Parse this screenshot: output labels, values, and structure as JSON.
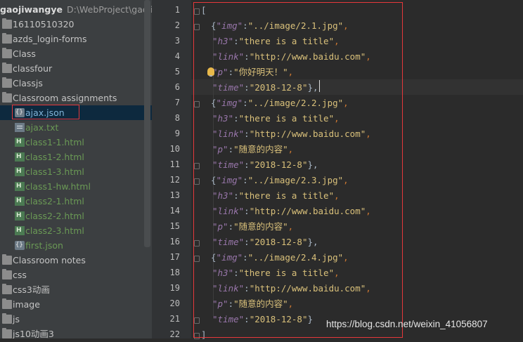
{
  "project": {
    "root_name": "gaojiwangye",
    "root_path": "D:\\WebProject\\gaojiwa"
  },
  "tree": [
    {
      "label": "16110510320",
      "icon": "folder-icon",
      "kind": "folder",
      "indent": 0
    },
    {
      "label": "azds_login-forms",
      "icon": "folder-icon",
      "kind": "folder",
      "indent": 0
    },
    {
      "label": "Class",
      "icon": "folder-icon",
      "kind": "folder",
      "indent": 0
    },
    {
      "label": "classfour",
      "icon": "folder-icon",
      "kind": "folder",
      "indent": 0
    },
    {
      "label": "Classjs",
      "icon": "folder-icon",
      "kind": "folder",
      "indent": 0
    },
    {
      "label": "Classroom assignments",
      "icon": "folder-icon",
      "kind": "folder",
      "indent": 0
    },
    {
      "label": "ajax.json",
      "icon": "json-file-icon",
      "kind": "json",
      "indent": 1,
      "selected": true
    },
    {
      "label": "ajax.txt",
      "icon": "text-file-icon",
      "kind": "txt",
      "indent": 1
    },
    {
      "label": "class1-1.html",
      "icon": "html-file-icon",
      "kind": "html",
      "indent": 1
    },
    {
      "label": "class1-2.html",
      "icon": "html-file-icon",
      "kind": "html",
      "indent": 1
    },
    {
      "label": "class1-3.html",
      "icon": "html-file-icon",
      "kind": "html",
      "indent": 1
    },
    {
      "label": "class1-hw.html",
      "icon": "html-file-icon",
      "kind": "html",
      "indent": 1
    },
    {
      "label": "class2-1.html",
      "icon": "html-file-icon",
      "kind": "html",
      "indent": 1
    },
    {
      "label": "class2-2.html",
      "icon": "html-file-icon",
      "kind": "html",
      "indent": 1
    },
    {
      "label": "class2-3.html",
      "icon": "html-file-icon",
      "kind": "html",
      "indent": 1
    },
    {
      "label": "first.json",
      "icon": "json-file-icon",
      "kind": "json",
      "indent": 1
    },
    {
      "label": "Classroom notes",
      "icon": "folder-icon",
      "kind": "folder",
      "indent": 0
    },
    {
      "label": "css",
      "icon": "folder-icon",
      "kind": "folder",
      "indent": 0
    },
    {
      "label": "css3动画",
      "icon": "folder-icon",
      "kind": "folder",
      "indent": 0
    },
    {
      "label": "image",
      "icon": "folder-icon",
      "kind": "folder",
      "indent": 0
    },
    {
      "label": "js",
      "icon": "folder-icon",
      "kind": "folder",
      "indent": 0
    },
    {
      "label": "js10动画3",
      "icon": "folder-icon",
      "kind": "folder",
      "indent": 0
    }
  ],
  "editor": {
    "line_numbers": [
      "1",
      "2",
      "3",
      "4",
      "5",
      "6",
      "7",
      "8",
      "9",
      "10",
      "11",
      "12",
      "13",
      "14",
      "15",
      "16",
      "17",
      "18",
      "19",
      "20",
      "21",
      "22"
    ],
    "lines": [
      [
        {
          "t": "[",
          "c": "b"
        }
      ],
      [
        {
          "t": "{",
          "c": "b"
        },
        {
          "t": "\"img\"",
          "c": "k"
        },
        {
          "t": ":",
          "c": "b"
        },
        {
          "t": "\"../image/2.1.jpg\"",
          "c": "s2"
        },
        {
          "t": ",",
          "c": "p"
        }
      ],
      [
        {
          "t": "  ",
          "c": "b"
        },
        {
          "t": "\"h3\"",
          "c": "k"
        },
        {
          "t": ":",
          "c": "b"
        },
        {
          "t": "\"there is a title\"",
          "c": "s2"
        },
        {
          "t": ",",
          "c": "p"
        }
      ],
      [
        {
          "t": "  ",
          "c": "b"
        },
        {
          "t": "\"link\"",
          "c": "k"
        },
        {
          "t": ":",
          "c": "b"
        },
        {
          "t": "\"http://www.baidu.com\"",
          "c": "s2"
        },
        {
          "t": ",",
          "c": "p"
        }
      ],
      [
        {
          "t": "  ",
          "c": "b"
        },
        {
          "t": "\"p\"",
          "c": "k"
        },
        {
          "t": ":",
          "c": "b"
        },
        {
          "t": "\"你好明天！\"",
          "c": "s2"
        },
        {
          "t": ",",
          "c": "p"
        }
      ],
      [
        {
          "t": "  ",
          "c": "b"
        },
        {
          "t": "\"time\"",
          "c": "k"
        },
        {
          "t": ":",
          "c": "b"
        },
        {
          "t": "\"2018-12-8\"",
          "c": "s2"
        },
        {
          "t": "},",
          "c": "b"
        }
      ],
      [
        {
          "t": "{",
          "c": "b"
        },
        {
          "t": "\"img\"",
          "c": "k"
        },
        {
          "t": ":",
          "c": "b"
        },
        {
          "t": "\"../image/2.2.jpg\"",
          "c": "s2"
        },
        {
          "t": ",",
          "c": "p"
        }
      ],
      [
        {
          "t": "  ",
          "c": "b"
        },
        {
          "t": "\"h3\"",
          "c": "k"
        },
        {
          "t": ":",
          "c": "b"
        },
        {
          "t": "\"there is a title\"",
          "c": "s2"
        },
        {
          "t": ",",
          "c": "p"
        }
      ],
      [
        {
          "t": "  ",
          "c": "b"
        },
        {
          "t": "\"link\"",
          "c": "k"
        },
        {
          "t": ":",
          "c": "b"
        },
        {
          "t": "\"http://www.baidu.com\"",
          "c": "s2"
        },
        {
          "t": ",",
          "c": "p"
        }
      ],
      [
        {
          "t": "  ",
          "c": "b"
        },
        {
          "t": "\"p\"",
          "c": "k"
        },
        {
          "t": ":",
          "c": "b"
        },
        {
          "t": "\"随意的内容\"",
          "c": "s2"
        },
        {
          "t": ",",
          "c": "p"
        }
      ],
      [
        {
          "t": "  ",
          "c": "b"
        },
        {
          "t": "\"time\"",
          "c": "k"
        },
        {
          "t": ":",
          "c": "b"
        },
        {
          "t": "\"2018-12-8\"",
          "c": "s2"
        },
        {
          "t": "},",
          "c": "b"
        }
      ],
      [
        {
          "t": "{",
          "c": "b"
        },
        {
          "t": "\"img\"",
          "c": "k"
        },
        {
          "t": ":",
          "c": "b"
        },
        {
          "t": "\"../image/2.3.jpg\"",
          "c": "s2"
        },
        {
          "t": ",",
          "c": "p"
        }
      ],
      [
        {
          "t": "  ",
          "c": "b"
        },
        {
          "t": "\"h3\"",
          "c": "k"
        },
        {
          "t": ":",
          "c": "b"
        },
        {
          "t": "\"there is a title\"",
          "c": "s2"
        },
        {
          "t": ",",
          "c": "p"
        }
      ],
      [
        {
          "t": "  ",
          "c": "b"
        },
        {
          "t": "\"link\"",
          "c": "k"
        },
        {
          "t": ":",
          "c": "b"
        },
        {
          "t": "\"http://www.baidu.com\"",
          "c": "s2"
        },
        {
          "t": ",",
          "c": "p"
        }
      ],
      [
        {
          "t": "  ",
          "c": "b"
        },
        {
          "t": "\"p\"",
          "c": "k"
        },
        {
          "t": ":",
          "c": "b"
        },
        {
          "t": "\"随意的内容\"",
          "c": "s2"
        },
        {
          "t": ",",
          "c": "p"
        }
      ],
      [
        {
          "t": "  ",
          "c": "b"
        },
        {
          "t": "\"time\"",
          "c": "k"
        },
        {
          "t": ":",
          "c": "b"
        },
        {
          "t": "\"2018-12-8\"",
          "c": "s2"
        },
        {
          "t": "},",
          "c": "b"
        }
      ],
      [
        {
          "t": "{",
          "c": "b"
        },
        {
          "t": "\"img\"",
          "c": "k"
        },
        {
          "t": ":",
          "c": "b"
        },
        {
          "t": "\"../image/2.4.jpg\"",
          "c": "s2"
        },
        {
          "t": ",",
          "c": "p"
        }
      ],
      [
        {
          "t": "  ",
          "c": "b"
        },
        {
          "t": "\"h3\"",
          "c": "k"
        },
        {
          "t": ":",
          "c": "b"
        },
        {
          "t": "\"there is a title\"",
          "c": "s2"
        },
        {
          "t": ",",
          "c": "p"
        }
      ],
      [
        {
          "t": "  ",
          "c": "b"
        },
        {
          "t": "\"link\"",
          "c": "k"
        },
        {
          "t": ":",
          "c": "b"
        },
        {
          "t": "\"http://www.baidu.com\"",
          "c": "s2"
        },
        {
          "t": ",",
          "c": "p"
        }
      ],
      [
        {
          "t": "  ",
          "c": "b"
        },
        {
          "t": "\"p\"",
          "c": "k"
        },
        {
          "t": ":",
          "c": "b"
        },
        {
          "t": "\"随意的内容\"",
          "c": "s2"
        },
        {
          "t": ",",
          "c": "p"
        }
      ],
      [
        {
          "t": "  ",
          "c": "b"
        },
        {
          "t": "\"time\"",
          "c": "k"
        },
        {
          "t": ":",
          "c": "b"
        },
        {
          "t": "\"2018-12-8\"",
          "c": "s2"
        },
        {
          "t": "}",
          "c": "b"
        }
      ],
      [
        {
          "t": "]",
          "c": "b"
        }
      ]
    ],
    "highlighted_line": 6
  },
  "watermark": "https://blog.csdn.net/weixin_41056807",
  "colors": {
    "editor_bg": "#2b2b2b",
    "tree_bg": "#3c3f41",
    "annotation_red": "#e5383b",
    "key_purple": "#9876aa",
    "string_yellow": "#d9c07a"
  }
}
